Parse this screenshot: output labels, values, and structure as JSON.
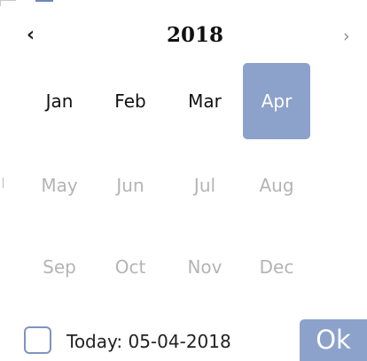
{
  "picker": {
    "year": "2018",
    "prev_glyph": "‹",
    "next_glyph": "›",
    "months": [
      {
        "label": "Jan",
        "state": "active"
      },
      {
        "label": "Feb",
        "state": "active"
      },
      {
        "label": "Mar",
        "state": "active"
      },
      {
        "label": "Apr",
        "state": "selected"
      },
      {
        "label": "May",
        "state": "disabled"
      },
      {
        "label": "Jun",
        "state": "disabled"
      },
      {
        "label": "Jul",
        "state": "disabled"
      },
      {
        "label": "Aug",
        "state": "disabled"
      },
      {
        "label": "Sep",
        "state": "disabled"
      },
      {
        "label": "Oct",
        "state": "disabled"
      },
      {
        "label": "Nov",
        "state": "disabled"
      },
      {
        "label": "Dec",
        "state": "disabled"
      }
    ]
  },
  "footer": {
    "today_label": "Today: 05-04-2018",
    "today_checked": false,
    "ok_label": "Ok"
  },
  "colors": {
    "accent": "#8ca2cb",
    "disabled_text": "#b4b4b4",
    "active_text": "#111111"
  },
  "icons": {
    "prev": "chevron-left-icon",
    "next": "chevron-right-icon",
    "checkbox": "checkbox-icon"
  }
}
